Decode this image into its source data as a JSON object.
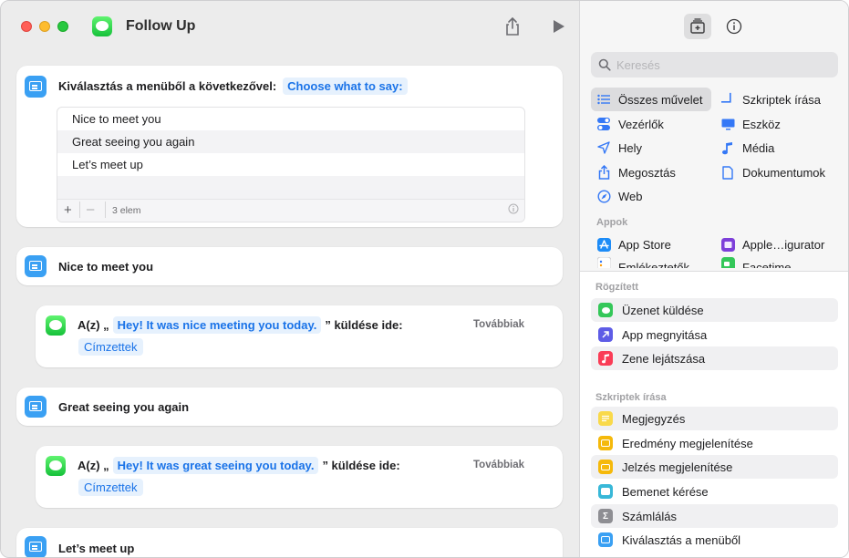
{
  "window": {
    "title": "Follow Up"
  },
  "editor": {
    "choose_menu": {
      "label": "Kiválasztás a menüből a következővel:",
      "prompt_token": "Choose what to say:",
      "items": [
        "Nice to meet you",
        "Great seeing you again",
        "Let’s meet up"
      ],
      "footer_count": "3 elem"
    },
    "case_1": {
      "label": "Nice to meet you"
    },
    "send_1": {
      "prefix": "A(z) „",
      "message": "Hey! It was nice meeting you today.",
      "suffix": "” küldése ide:",
      "more": "Továbbiak",
      "recipients": "Címzettek"
    },
    "case_2": {
      "label": "Great seeing you again"
    },
    "send_2": {
      "prefix": "A(z) „",
      "message": "Hey! It was great seeing you today.",
      "suffix": "” küldése ide:",
      "more": "Továbbiak",
      "recipients": "Címzettek"
    },
    "case_3": {
      "label": "Let’s meet up"
    }
  },
  "library": {
    "search_placeholder": "Keresés",
    "categories": [
      {
        "label": "Összes művelet",
        "icon": "list-icon"
      },
      {
        "label": "Szkriptek írása",
        "icon": "script-icon"
      },
      {
        "label": "Vezérlők",
        "icon": "toggle-icon"
      },
      {
        "label": "Eszköz",
        "icon": "display-icon"
      },
      {
        "label": "Hely",
        "icon": "location-arrow-icon"
      },
      {
        "label": "Média",
        "icon": "music-note-icon"
      },
      {
        "label": "Megosztás",
        "icon": "share-icon"
      },
      {
        "label": "Dokumentumok",
        "icon": "document-icon"
      },
      {
        "label": "Web",
        "icon": "compass-icon"
      }
    ],
    "apps_header": "Appok",
    "apps": [
      {
        "label": "App Store",
        "icon": "app-store-icon"
      },
      {
        "label": "Apple…igurator",
        "icon": "configurator-icon"
      },
      {
        "label": "Emlékeztetők",
        "icon": "reminders-icon"
      },
      {
        "label": "Facetime",
        "icon": "facetime-icon"
      }
    ],
    "pinned_header": "Rögzített",
    "pinned": [
      {
        "label": "Üzenet küldése",
        "color": "#34c759"
      },
      {
        "label": "App megnyitása",
        "color": "#5e5ce6"
      },
      {
        "label": "Zene lejátszása",
        "color": "#fa3c56"
      }
    ],
    "scripting_header": "Szkriptek írása",
    "scripting": [
      {
        "label": "Megjegyzés",
        "color": "#f9d94a"
      },
      {
        "label": "Eredmény megjelenítése",
        "color": "#f5b90b"
      },
      {
        "label": "Jelzés megjelenítése",
        "color": "#f5b90b"
      },
      {
        "label": "Bemenet kérése",
        "color": "#38b8d8"
      },
      {
        "label": "Számlálás",
        "color": "#8e8e93"
      },
      {
        "label": "Kiválasztás a menüből",
        "color": "#3aa0f3"
      }
    ]
  }
}
